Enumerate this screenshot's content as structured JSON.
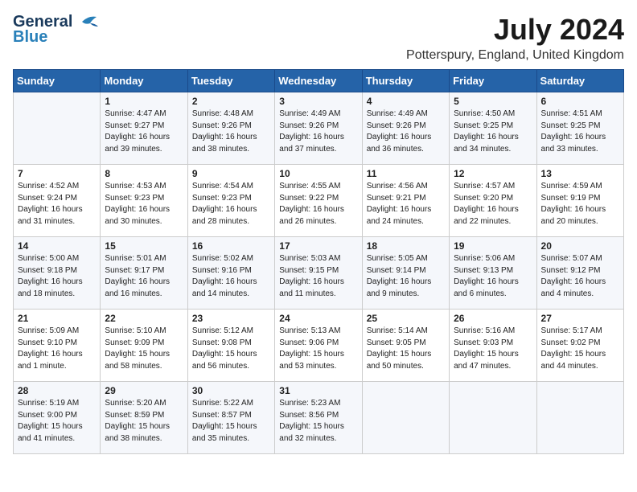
{
  "header": {
    "logo_general": "General",
    "logo_blue": "Blue",
    "month_year": "July 2024",
    "location": "Potterspury, England, United Kingdom"
  },
  "days_of_week": [
    "Sunday",
    "Monday",
    "Tuesday",
    "Wednesday",
    "Thursday",
    "Friday",
    "Saturday"
  ],
  "weeks": [
    [
      {
        "day": "",
        "info": ""
      },
      {
        "day": "1",
        "info": "Sunrise: 4:47 AM\nSunset: 9:27 PM\nDaylight: 16 hours\nand 39 minutes."
      },
      {
        "day": "2",
        "info": "Sunrise: 4:48 AM\nSunset: 9:26 PM\nDaylight: 16 hours\nand 38 minutes."
      },
      {
        "day": "3",
        "info": "Sunrise: 4:49 AM\nSunset: 9:26 PM\nDaylight: 16 hours\nand 37 minutes."
      },
      {
        "day": "4",
        "info": "Sunrise: 4:49 AM\nSunset: 9:26 PM\nDaylight: 16 hours\nand 36 minutes."
      },
      {
        "day": "5",
        "info": "Sunrise: 4:50 AM\nSunset: 9:25 PM\nDaylight: 16 hours\nand 34 minutes."
      },
      {
        "day": "6",
        "info": "Sunrise: 4:51 AM\nSunset: 9:25 PM\nDaylight: 16 hours\nand 33 minutes."
      }
    ],
    [
      {
        "day": "7",
        "info": "Sunrise: 4:52 AM\nSunset: 9:24 PM\nDaylight: 16 hours\nand 31 minutes."
      },
      {
        "day": "8",
        "info": "Sunrise: 4:53 AM\nSunset: 9:23 PM\nDaylight: 16 hours\nand 30 minutes."
      },
      {
        "day": "9",
        "info": "Sunrise: 4:54 AM\nSunset: 9:23 PM\nDaylight: 16 hours\nand 28 minutes."
      },
      {
        "day": "10",
        "info": "Sunrise: 4:55 AM\nSunset: 9:22 PM\nDaylight: 16 hours\nand 26 minutes."
      },
      {
        "day": "11",
        "info": "Sunrise: 4:56 AM\nSunset: 9:21 PM\nDaylight: 16 hours\nand 24 minutes."
      },
      {
        "day": "12",
        "info": "Sunrise: 4:57 AM\nSunset: 9:20 PM\nDaylight: 16 hours\nand 22 minutes."
      },
      {
        "day": "13",
        "info": "Sunrise: 4:59 AM\nSunset: 9:19 PM\nDaylight: 16 hours\nand 20 minutes."
      }
    ],
    [
      {
        "day": "14",
        "info": "Sunrise: 5:00 AM\nSunset: 9:18 PM\nDaylight: 16 hours\nand 18 minutes."
      },
      {
        "day": "15",
        "info": "Sunrise: 5:01 AM\nSunset: 9:17 PM\nDaylight: 16 hours\nand 16 minutes."
      },
      {
        "day": "16",
        "info": "Sunrise: 5:02 AM\nSunset: 9:16 PM\nDaylight: 16 hours\nand 14 minutes."
      },
      {
        "day": "17",
        "info": "Sunrise: 5:03 AM\nSunset: 9:15 PM\nDaylight: 16 hours\nand 11 minutes."
      },
      {
        "day": "18",
        "info": "Sunrise: 5:05 AM\nSunset: 9:14 PM\nDaylight: 16 hours\nand 9 minutes."
      },
      {
        "day": "19",
        "info": "Sunrise: 5:06 AM\nSunset: 9:13 PM\nDaylight: 16 hours\nand 6 minutes."
      },
      {
        "day": "20",
        "info": "Sunrise: 5:07 AM\nSunset: 9:12 PM\nDaylight: 16 hours\nand 4 minutes."
      }
    ],
    [
      {
        "day": "21",
        "info": "Sunrise: 5:09 AM\nSunset: 9:10 PM\nDaylight: 16 hours\nand 1 minute."
      },
      {
        "day": "22",
        "info": "Sunrise: 5:10 AM\nSunset: 9:09 PM\nDaylight: 15 hours\nand 58 minutes."
      },
      {
        "day": "23",
        "info": "Sunrise: 5:12 AM\nSunset: 9:08 PM\nDaylight: 15 hours\nand 56 minutes."
      },
      {
        "day": "24",
        "info": "Sunrise: 5:13 AM\nSunset: 9:06 PM\nDaylight: 15 hours\nand 53 minutes."
      },
      {
        "day": "25",
        "info": "Sunrise: 5:14 AM\nSunset: 9:05 PM\nDaylight: 15 hours\nand 50 minutes."
      },
      {
        "day": "26",
        "info": "Sunrise: 5:16 AM\nSunset: 9:03 PM\nDaylight: 15 hours\nand 47 minutes."
      },
      {
        "day": "27",
        "info": "Sunrise: 5:17 AM\nSunset: 9:02 PM\nDaylight: 15 hours\nand 44 minutes."
      }
    ],
    [
      {
        "day": "28",
        "info": "Sunrise: 5:19 AM\nSunset: 9:00 PM\nDaylight: 15 hours\nand 41 minutes."
      },
      {
        "day": "29",
        "info": "Sunrise: 5:20 AM\nSunset: 8:59 PM\nDaylight: 15 hours\nand 38 minutes."
      },
      {
        "day": "30",
        "info": "Sunrise: 5:22 AM\nSunset: 8:57 PM\nDaylight: 15 hours\nand 35 minutes."
      },
      {
        "day": "31",
        "info": "Sunrise: 5:23 AM\nSunset: 8:56 PM\nDaylight: 15 hours\nand 32 minutes."
      },
      {
        "day": "",
        "info": ""
      },
      {
        "day": "",
        "info": ""
      },
      {
        "day": "",
        "info": ""
      }
    ]
  ]
}
